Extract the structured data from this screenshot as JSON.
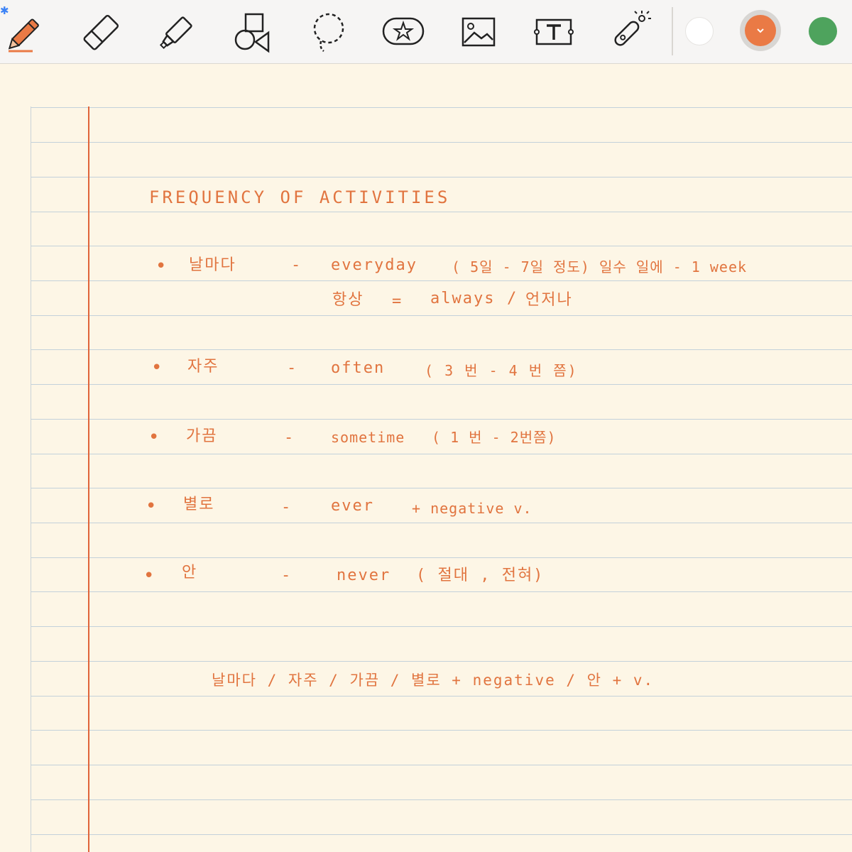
{
  "toolbar": {
    "tools": [
      {
        "name": "pen-tool",
        "icon": "pen-icon",
        "selected": true
      },
      {
        "name": "eraser-tool",
        "icon": "eraser-icon"
      },
      {
        "name": "highlighter-tool",
        "icon": "highlighter-icon"
      },
      {
        "name": "shapes-tool",
        "icon": "shapes-icon"
      },
      {
        "name": "lasso-tool",
        "icon": "lasso-icon"
      },
      {
        "name": "elements-tool",
        "icon": "sticker-icon"
      },
      {
        "name": "image-tool",
        "icon": "image-icon"
      },
      {
        "name": "text-tool",
        "icon": "text-box-icon"
      },
      {
        "name": "laser-pointer-tool",
        "icon": "laser-pointer-icon"
      }
    ],
    "colors": {
      "white": "#ffffff",
      "orange": "#ea7a45",
      "green": "#4ea35d"
    },
    "selected_color": "orange"
  },
  "note": {
    "ink_color": "#e1743f",
    "title": "FREQUENCY OF ACTIVITIES",
    "items": [
      {
        "korean": "날마다",
        "dash": "-",
        "english": "everyday",
        "detail": "( 5일 - 7일 정도) 일수 일에 - 1 week",
        "sub_line": {
          "korean": "항상",
          "eq": "=",
          "english": "always",
          "slash": "/",
          "korean2": "언저나"
        }
      },
      {
        "korean": "자주",
        "dash": "-",
        "english": "often",
        "detail": "( 3 번 - 4 번 쯤)"
      },
      {
        "korean": "가끔",
        "dash": "-",
        "english": "sometime",
        "detail": "( 1 번 - 2번쯤)"
      },
      {
        "korean": "별로",
        "dash": "-",
        "english": "ever",
        "detail": "+ negative v."
      },
      {
        "korean": "안",
        "dash": "-",
        "english": "never",
        "detail": "( 절대 , 전혀)"
      }
    ],
    "summary": "날마다 / 자주 / 가끔 / 별로 + negative / 안 + v."
  }
}
